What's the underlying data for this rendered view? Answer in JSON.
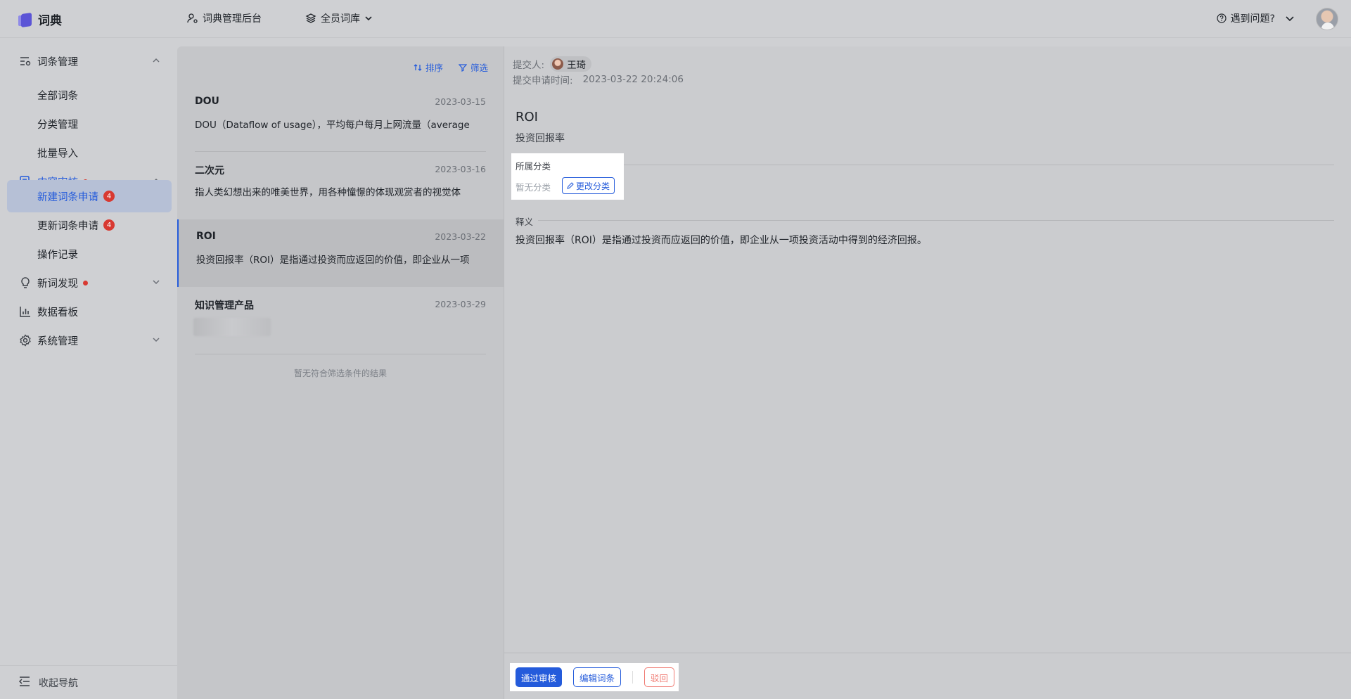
{
  "app": {
    "title": "词典"
  },
  "topbar": {
    "admin_label": "词典管理后台",
    "library_label": "全员词库",
    "help_label": "遇到问题?"
  },
  "sidebar": {
    "groups": [
      {
        "label": "词条管理",
        "icon": "list-settings-icon",
        "expanded": true,
        "children": [
          "全部词条",
          "分类管理",
          "批量导入"
        ]
      },
      {
        "label": "内容审核",
        "icon": "audit-icon",
        "expanded": true,
        "active": true,
        "dot": true,
        "children": [
          {
            "label": "新建词条申请",
            "badge": "4",
            "active": true
          },
          {
            "label": "更新词条申请",
            "badge": "4"
          },
          {
            "label": "操作记录"
          }
        ]
      },
      {
        "label": "新词发现",
        "icon": "bulb-icon",
        "dot": true,
        "expanded": false
      },
      {
        "label": "数据看板",
        "icon": "bar-chart-icon"
      },
      {
        "label": "系统管理",
        "icon": "gear-icon",
        "expanded": false
      }
    ],
    "collapse_label": "收起导航"
  },
  "list": {
    "sort_label": "排序",
    "filter_label": "筛选",
    "items": [
      {
        "title": "DOU",
        "date": "2023-03-15",
        "desc": "DOU（Dataflow of usage），平均每户每月上网流量（average"
      },
      {
        "title": "二次元",
        "date": "2023-03-16",
        "desc": "指人类幻想出来的唯美世界，用各种憧憬的体现观赏者的视觉体"
      },
      {
        "title": "ROI",
        "date": "2023-03-22",
        "desc": "投资回报率（ROI）是指通过投资而应返回的价值，即企业从一项",
        "active": true
      },
      {
        "title": "知识管理产品",
        "date": "2023-03-29",
        "desc": ""
      }
    ],
    "empty_hint": "暂无符合筛选条件的结果"
  },
  "detail": {
    "submitter_label": "提交人:",
    "submitter_name": "王琦",
    "submit_time_label": "提交申请时间:",
    "submit_time": "2023-03-22 20:24:06",
    "term": "ROI",
    "term_subtitle": "投资回报率",
    "category_header": "所属分类",
    "category_value": "暂无分类",
    "change_category": "更改分类",
    "definition_header": "释义",
    "definition": "投资回报率（ROI）是指通过投资而应返回的价值，即企业从一项投资活动中得到的经济回报。"
  },
  "actions": {
    "approve": "通过审核",
    "edit": "编辑词条",
    "reject": "驳回"
  },
  "colors": {
    "accent": "#245bdb",
    "badge": "#d83931",
    "danger": "#f07b73"
  }
}
